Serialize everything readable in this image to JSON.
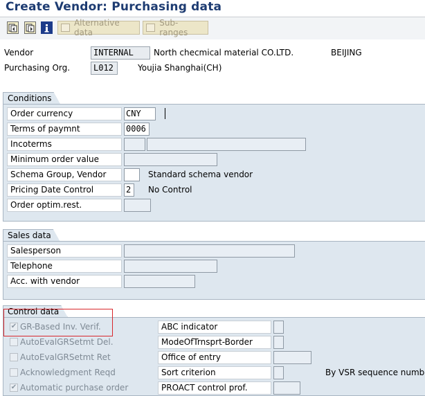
{
  "window": {
    "title": "Create Vendor: Purchasing data"
  },
  "toolbar": {
    "buttons": [
      {
        "icon": "previous-screen-icon"
      },
      {
        "icon": "next-screen-icon"
      },
      {
        "icon": "info-icon"
      }
    ],
    "alt_data_label": "Alternative data",
    "subranges_label": "Sub-ranges"
  },
  "header": {
    "vendor_label": "Vendor",
    "vendor_value": "INTERNAL",
    "vendor_name": "North checmical material CO.LTD.",
    "vendor_city": "BEIJING",
    "porg_label": "Purchasing Org.",
    "porg_value": "L012",
    "porg_name": "Youjia Shanghai(CH)"
  },
  "conditions": {
    "title": "Conditions",
    "order_currency": {
      "label": "Order currency",
      "value": "CNY"
    },
    "terms_of_payment": {
      "label": "Terms of paymnt",
      "value": "0006"
    },
    "incoterms": {
      "label": "Incoterms",
      "value1": "",
      "value2": ""
    },
    "min_order_value": {
      "label": "Minimum order value",
      "value": ""
    },
    "schema_group": {
      "label": "Schema Group, Vendor",
      "value": "",
      "desc": "Standard schema vendor"
    },
    "pricing_date_control": {
      "label": "Pricing Date Control",
      "value": "2",
      "desc": "No Control"
    },
    "order_optim": {
      "label": "Order optim.rest.",
      "value": ""
    }
  },
  "sales": {
    "title": "Sales data",
    "salesperson": {
      "label": "Salesperson",
      "value": ""
    },
    "telephone": {
      "label": "Telephone",
      "value": ""
    },
    "acc_with_vendor": {
      "label": "Acc. with vendor",
      "value": ""
    }
  },
  "control": {
    "title": "Control data",
    "gr_based_inv": {
      "label": "GR-Based Inv. Verif.",
      "checked": "✔"
    },
    "auto_eval_del": {
      "label": "AutoEvalGRSetmt Del.",
      "checked": ""
    },
    "auto_eval_ret": {
      "label": "AutoEvalGRSetmt Ret",
      "checked": ""
    },
    "ack_reqd": {
      "label": "Acknowledgment Reqd",
      "checked": ""
    },
    "auto_po": {
      "label": "Automatic purchase order",
      "checked": "✔"
    },
    "abc_indicator": {
      "label": "ABC indicator",
      "value": ""
    },
    "mode_transport": {
      "label": "ModeOfTrnsprt-Border",
      "value": ""
    },
    "office_entry": {
      "label": "Office of entry",
      "value": ""
    },
    "sort_criterion": {
      "label": "Sort criterion",
      "value": "",
      "desc": "By VSR sequence number"
    },
    "proact": {
      "label": "PROACT control prof.",
      "value": ""
    }
  },
  "colors": {
    "accent": "#1e3c72",
    "group_bg": "#dee7ef",
    "highlight": "#d8262b"
  }
}
